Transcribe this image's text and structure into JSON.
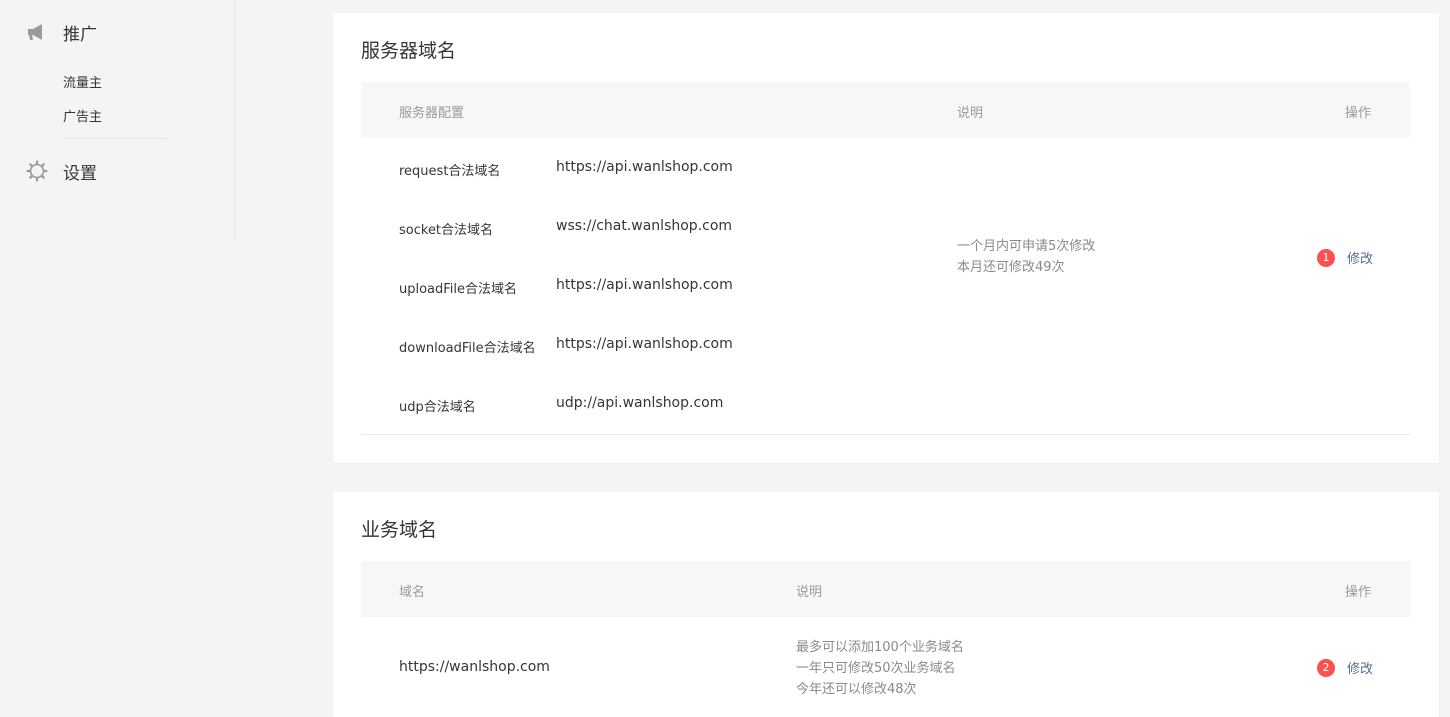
{
  "sidebar": {
    "promo": {
      "label": "推广",
      "icon": "megaphone-icon"
    },
    "sub_items": [
      {
        "label": "流量主"
      },
      {
        "label": "广告主"
      }
    ],
    "settings": {
      "label": "设置",
      "icon": "gear-icon"
    }
  },
  "server_domains": {
    "title": "服务器域名",
    "columns": {
      "config": "服务器配置",
      "desc": "说明",
      "action": "操作"
    },
    "rows": [
      {
        "name": "request合法域名",
        "value": "https://api.wanlshop.com"
      },
      {
        "name": "socket合法域名",
        "value": "wss://chat.wanlshop.com"
      },
      {
        "name": "uploadFile合法域名",
        "value": "https://api.wanlshop.com"
      },
      {
        "name": "downloadFile合法域名",
        "value": "https://api.wanlshop.com"
      },
      {
        "name": "udp合法域名",
        "value": "udp://api.wanlshop.com"
      }
    ],
    "desc_lines": [
      "一个月内可申请5次修改",
      "本月还可修改49次"
    ],
    "badge": "1",
    "action_label": "修改"
  },
  "business_domains": {
    "title": "业务域名",
    "columns": {
      "domain": "域名",
      "desc": "说明",
      "action": "操作"
    },
    "row": {
      "domain": "https://wanlshop.com"
    },
    "desc_lines": [
      "最多可以添加100个业务域名",
      "一年只可修改50次业务域名",
      "今年还可以修改48次"
    ],
    "badge": "2",
    "action_label": "修改"
  },
  "colors": {
    "accent_link": "#576b95",
    "badge_red": "#fa5151",
    "header_bg": "#f6f7f9"
  }
}
